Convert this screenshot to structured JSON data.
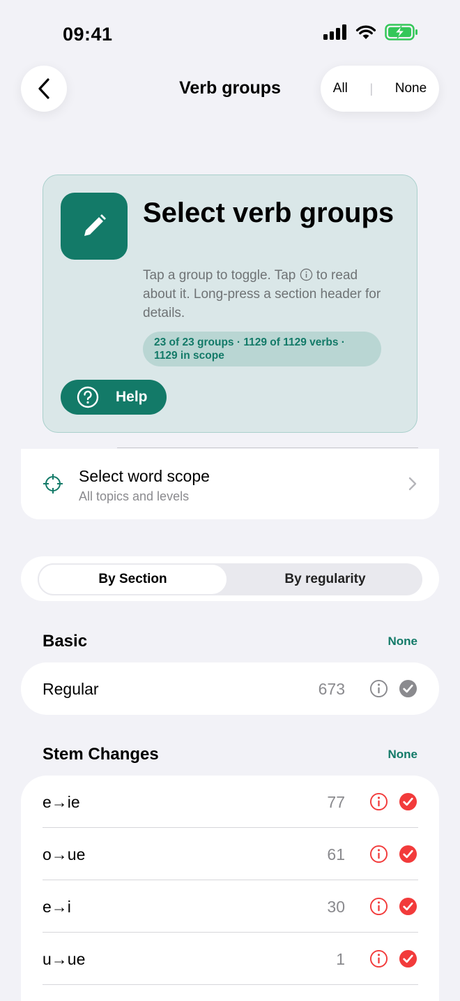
{
  "status": {
    "time": "09:41"
  },
  "nav": {
    "title": "Verb groups",
    "all_label": "All",
    "separator": "|",
    "none_label": "None"
  },
  "hero": {
    "title": "Select verb groups",
    "desc_before": "Tap a group to toggle. Tap ",
    "desc_after": " to read about it. Long-press a section header for details.",
    "badge": "23 of 23 groups · 1129 of 1129 verbs · 1129 in scope",
    "help_label": "Help",
    "accent": "#137a68"
  },
  "scope": {
    "title": "Select word scope",
    "subtitle": "All topics and levels"
  },
  "segments": {
    "left": "By Section",
    "right": "By regularity",
    "selected": "left"
  },
  "sections": [
    {
      "title": "Basic",
      "none_label": "None",
      "items": [
        {
          "label": "Regular",
          "count": "673",
          "checked": true,
          "color": "#8a8a8e"
        }
      ]
    },
    {
      "title": "Stem Changes",
      "none_label": "None",
      "items": [
        {
          "label": "e→ie",
          "count": "77",
          "checked": true,
          "color": "#f23b3b"
        },
        {
          "label": "o→ue",
          "count": "61",
          "checked": true,
          "color": "#f23b3b"
        },
        {
          "label": "e→i",
          "count": "30",
          "checked": true,
          "color": "#f23b3b"
        },
        {
          "label": "u→ue",
          "count": "1",
          "checked": true,
          "color": "#f23b3b"
        }
      ]
    }
  ]
}
